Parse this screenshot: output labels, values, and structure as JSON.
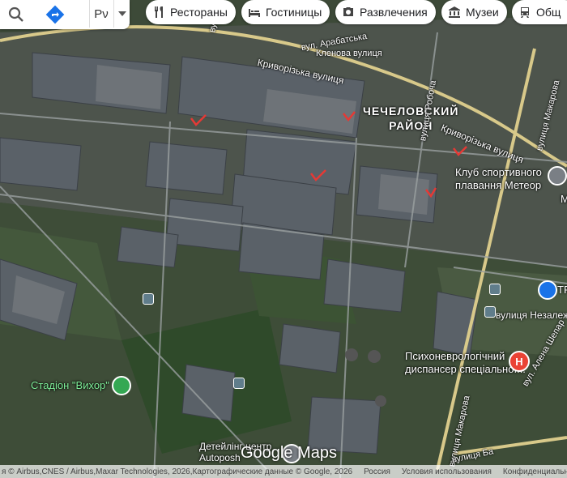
{
  "categories": [
    {
      "label": "Рестораны",
      "icon": "restaurant-icon"
    },
    {
      "label": "Гостиницы",
      "icon": "hotel-icon"
    },
    {
      "label": "Развлечения",
      "icon": "camera-icon"
    },
    {
      "label": "Музеи",
      "icon": "museum-icon"
    },
    {
      "label": "Общ",
      "icon": "transit-icon"
    }
  ],
  "search": {
    "lang": "Рν"
  },
  "map": {
    "district": [
      "ЧЕЧЕЛОВСКИЙ",
      "РАЙОН"
    ],
    "streets": {
      "kryvorizka_1": "Криворізька вулиця",
      "kryvorizka_2": "Криворізька вулиця",
      "arabatska": "вул. Арабатська",
      "klenova": "Кленова вулиця",
      "robocha": "вулиця Робоча",
      "makarova": "вулиця Макарова",
      "makarova_2": "вулиця Макарова",
      "nezalezhnosti": "вулиця Незалеж",
      "shepar": "вул. Алена Шепар",
      "bottom": "вулиця Ба",
      "top_vul": "вул."
    },
    "pois": {
      "meteor_1": "Клуб спортивного",
      "meteor_2": "плавання Метеор",
      "hospital_1": "Психоневрологічний",
      "hospital_2": "диспансер спеціальної...",
      "stadium": "Стадіон \"Вихор\"",
      "center_1": "Детейлінг центр",
      "center_2": "Autoposh",
      "tr": "TR",
      "m": "M"
    },
    "logo": "Google Maps"
  },
  "footer": {
    "attribution": "я © Airbus,CNES / Airbus,Maxar Technologies, 2026,Картографические данные © Google, 2026",
    "country": "Россия",
    "terms": "Условия использования",
    "privacy": "Конфиденциальность"
  },
  "colors": {
    "hospital": "#ea4335",
    "stadium": "#34a853",
    "accent": "#1a73e8",
    "mark": "#e53935"
  }
}
